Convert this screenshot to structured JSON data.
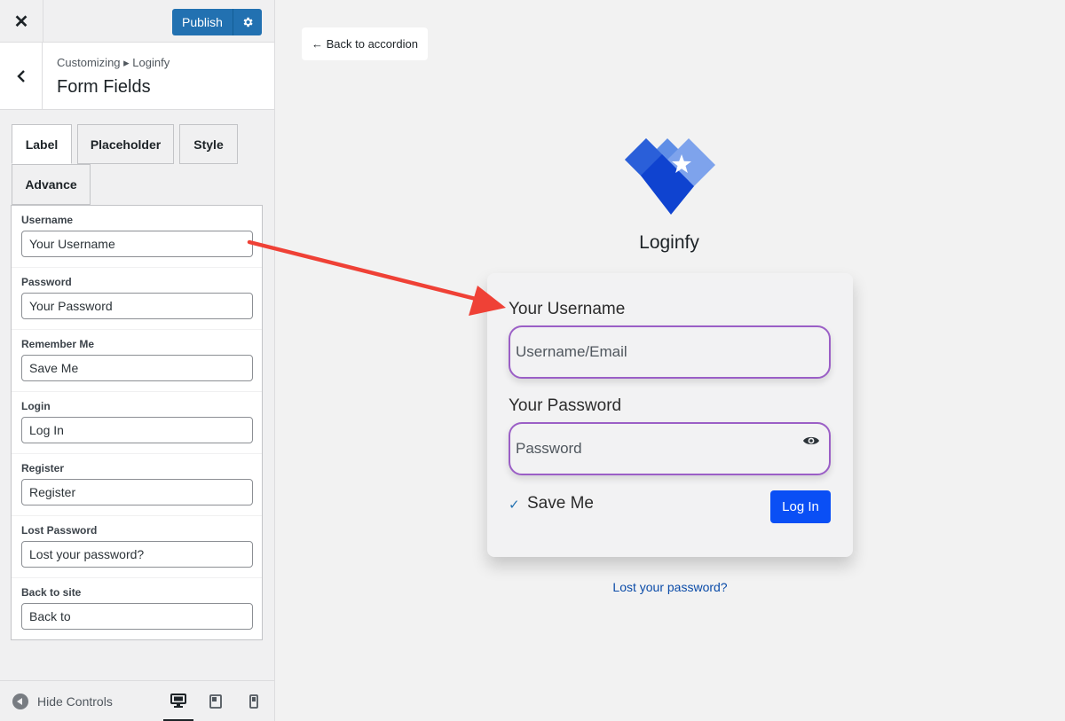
{
  "topbar": {
    "close_symbol": "✕",
    "publish_label": "Publish",
    "settings_icon": "gear-icon"
  },
  "section": {
    "breadcrumb": "Customizing ▸ Loginfy",
    "title": "Form Fields"
  },
  "tabs": [
    "Label",
    "Placeholder",
    "Style",
    "Advance"
  ],
  "fields": [
    {
      "label": "Username",
      "value": "Your Username"
    },
    {
      "label": "Password",
      "value": "Your Password"
    },
    {
      "label": "Remember Me",
      "value": "Save Me"
    },
    {
      "label": "Login",
      "value": "Log In"
    },
    {
      "label": "Register",
      "value": "Register"
    },
    {
      "label": "Lost Password",
      "value": "Lost your password?"
    },
    {
      "label": "Back to site",
      "value": "Back to"
    }
  ],
  "footer": {
    "hide_controls": "Hide Controls"
  },
  "preview": {
    "back_link": "← Back to accordion",
    "logo_text": "Loginfy",
    "username_label": "Your Username",
    "username_placeholder": "Username/Email",
    "password_label": "Your Password",
    "password_placeholder": "Password",
    "remember_label": "Save Me",
    "login_button": "Log In",
    "lost_password": "Lost your password?"
  },
  "colors": {
    "accent": "#2271b1",
    "login_button": "#0a4ff5",
    "input_border": "#9b5fc6",
    "annotation_arrow": "#ef4136"
  }
}
